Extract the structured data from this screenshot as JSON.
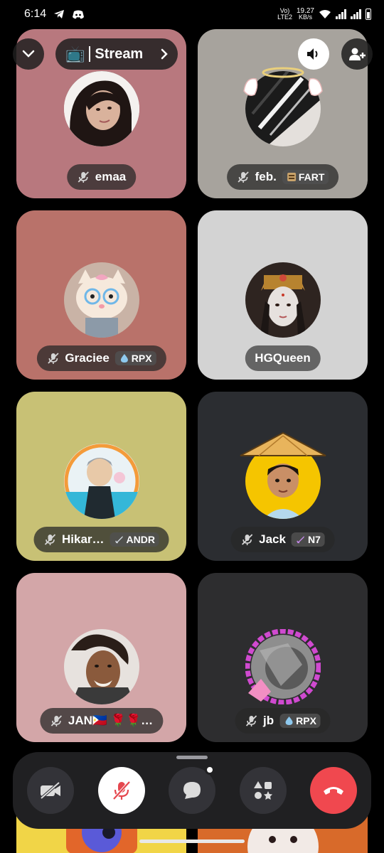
{
  "status_bar": {
    "time": "6:14",
    "net_badge_top": "Vo)",
    "net_badge_bottom": "LTE2",
    "speed_value": "19.27",
    "speed_unit": "KB/s"
  },
  "header": {
    "stream_label": "Stream",
    "stream_emoji": "📺"
  },
  "participants": [
    {
      "name": "emaa",
      "muted": true,
      "tag": ""
    },
    {
      "name": "feb.",
      "muted": true,
      "tag": "FART"
    },
    {
      "name": "Graciee",
      "muted": true,
      "tag": "RPX"
    },
    {
      "name": "HGQueen",
      "muted": false,
      "tag": ""
    },
    {
      "name": "Hikar…",
      "muted": true,
      "tag": "ANDR"
    },
    {
      "name": "Jack",
      "muted": true,
      "tag": "N7"
    },
    {
      "name": "JAN🇵🇭 🌹🌹…",
      "muted": true,
      "tag": ""
    },
    {
      "name": "jb",
      "muted": true,
      "tag": "RPX"
    }
  ],
  "controls": {
    "camera": "camera-off",
    "mic": "mic-off",
    "chat": "chat",
    "activities": "activities",
    "disconnect": "end-call"
  },
  "colors": {
    "tile_emaa": "#b8787e",
    "tile_feb": "#a7a39d",
    "tile_graciee": "#b9726a",
    "tile_hgqueen": "#d3d3d3",
    "tile_hikaru": "#c8c175",
    "tile_jack": "#2b2d31",
    "tile_jan": "#d3a6a8",
    "tile_jb": "#2d2d2f",
    "end_call": "#f0484f"
  }
}
